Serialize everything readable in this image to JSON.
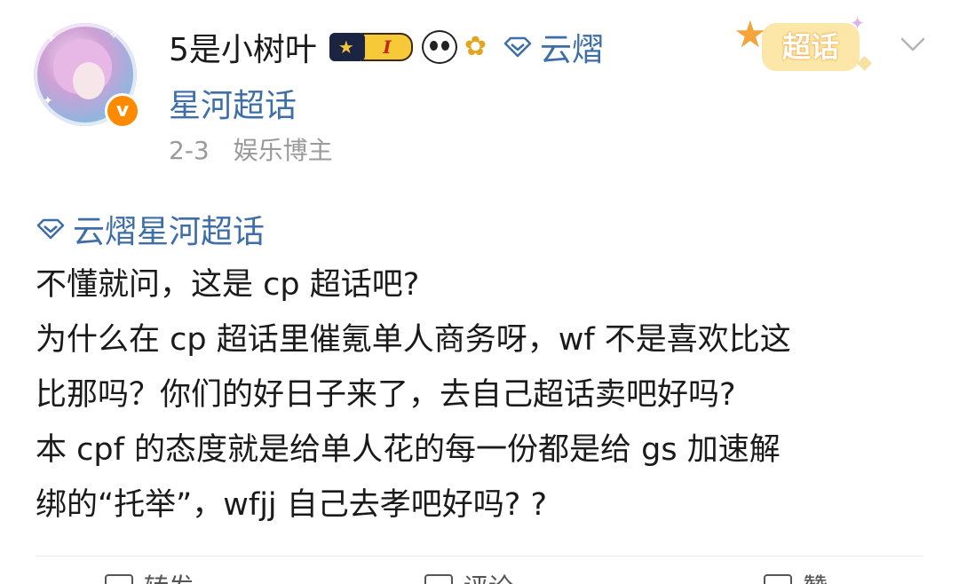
{
  "author": {
    "name": "5是小树叶",
    "level_badge": "I",
    "verified_mark": "v"
  },
  "header_topic": {
    "line1": "云熠",
    "line2": "星河超话"
  },
  "meta": {
    "date": "2-3",
    "role": "娱乐博主"
  },
  "supertopic_tag": {
    "label": "超话"
  },
  "post": {
    "topic": "云熠星河超话",
    "lines": [
      "不懂就问，这是 cp 超话吧?",
      "为什么在 cp 超话里催氪单人商务呀，wf 不是喜欢比这",
      "比那吗？你们的好日子来了，去自己超话卖吧好吗?",
      "本 cpf 的态度就是给单人花的每一份都是给 gs 加速解",
      "绑的“托举”，wfjj 自己去孝吧好吗? ?"
    ]
  },
  "actions": {
    "repost": "转发",
    "comment": "评论",
    "like": "赞"
  },
  "colors": {
    "link": "#3e6ea8",
    "meta": "#9a9a9a",
    "verified": "#ff8a00"
  }
}
